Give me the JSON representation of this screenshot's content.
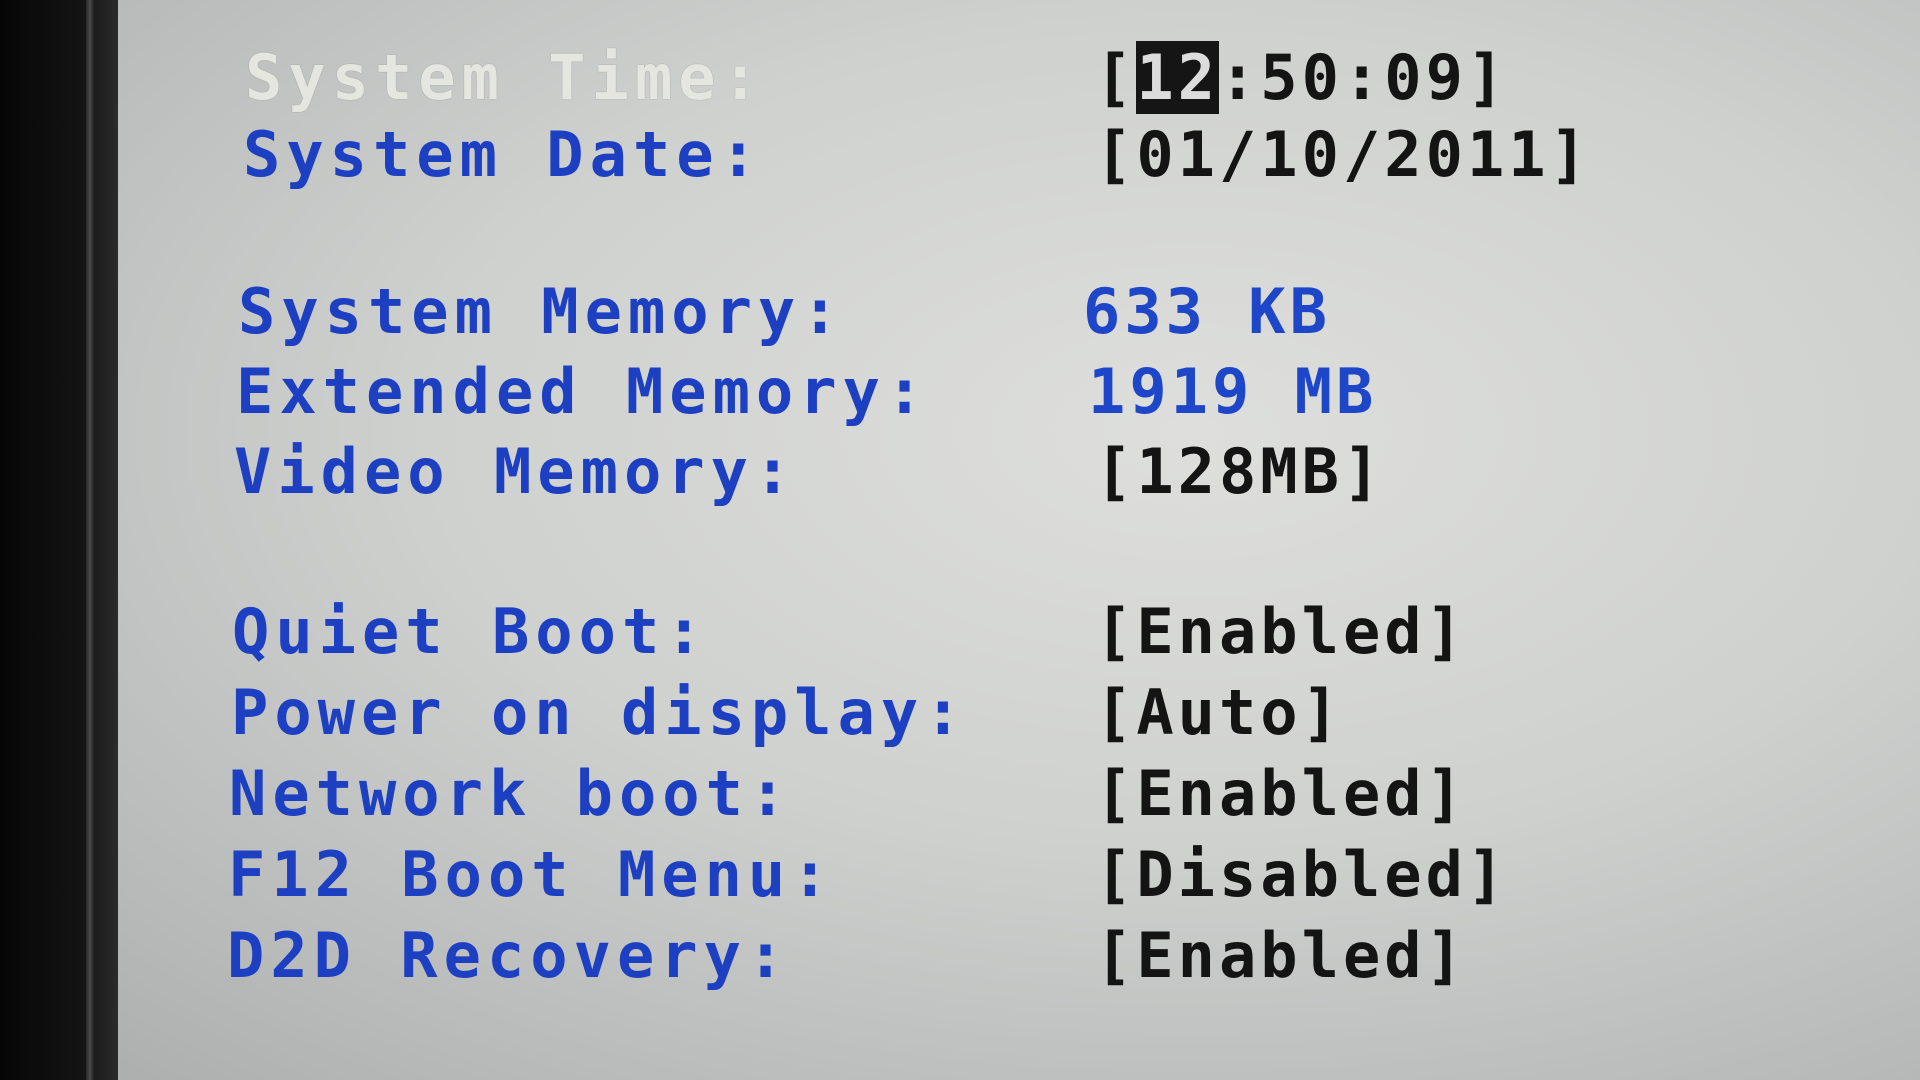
{
  "system_time": {
    "label": "System Time:",
    "open_bracket": "[",
    "hour": "12",
    "rest": ":50:09",
    "close_bracket": "]"
  },
  "system_date": {
    "label": "System Date:",
    "value": "[01/10/2011]"
  },
  "system_memory": {
    "label": "System Memory:",
    "value": "633 KB"
  },
  "extended_memory": {
    "label": "Extended Memory:",
    "value": "1919 MB"
  },
  "video_memory": {
    "label": "Video Memory:",
    "value": "[128MB]"
  },
  "quiet_boot": {
    "label": "Quiet Boot:",
    "value": "[Enabled]"
  },
  "power_on_display": {
    "label": "Power on display:",
    "value": "[Auto]"
  },
  "network_boot": {
    "label": "Network boot:",
    "value": "[Enabled]"
  },
  "f12_boot_menu": {
    "label": "F12 Boot Menu:",
    "value": "[Disabled]"
  },
  "d2d_recovery": {
    "label": "D2D Recovery:",
    "value": "[Enabled]"
  },
  "colors": {
    "label_blue": "#1d3fc2",
    "selected_label": "#e6e6e0",
    "value_black": "#141414",
    "info_blue": "#1e46c8",
    "cursor_bg": "#151515"
  }
}
